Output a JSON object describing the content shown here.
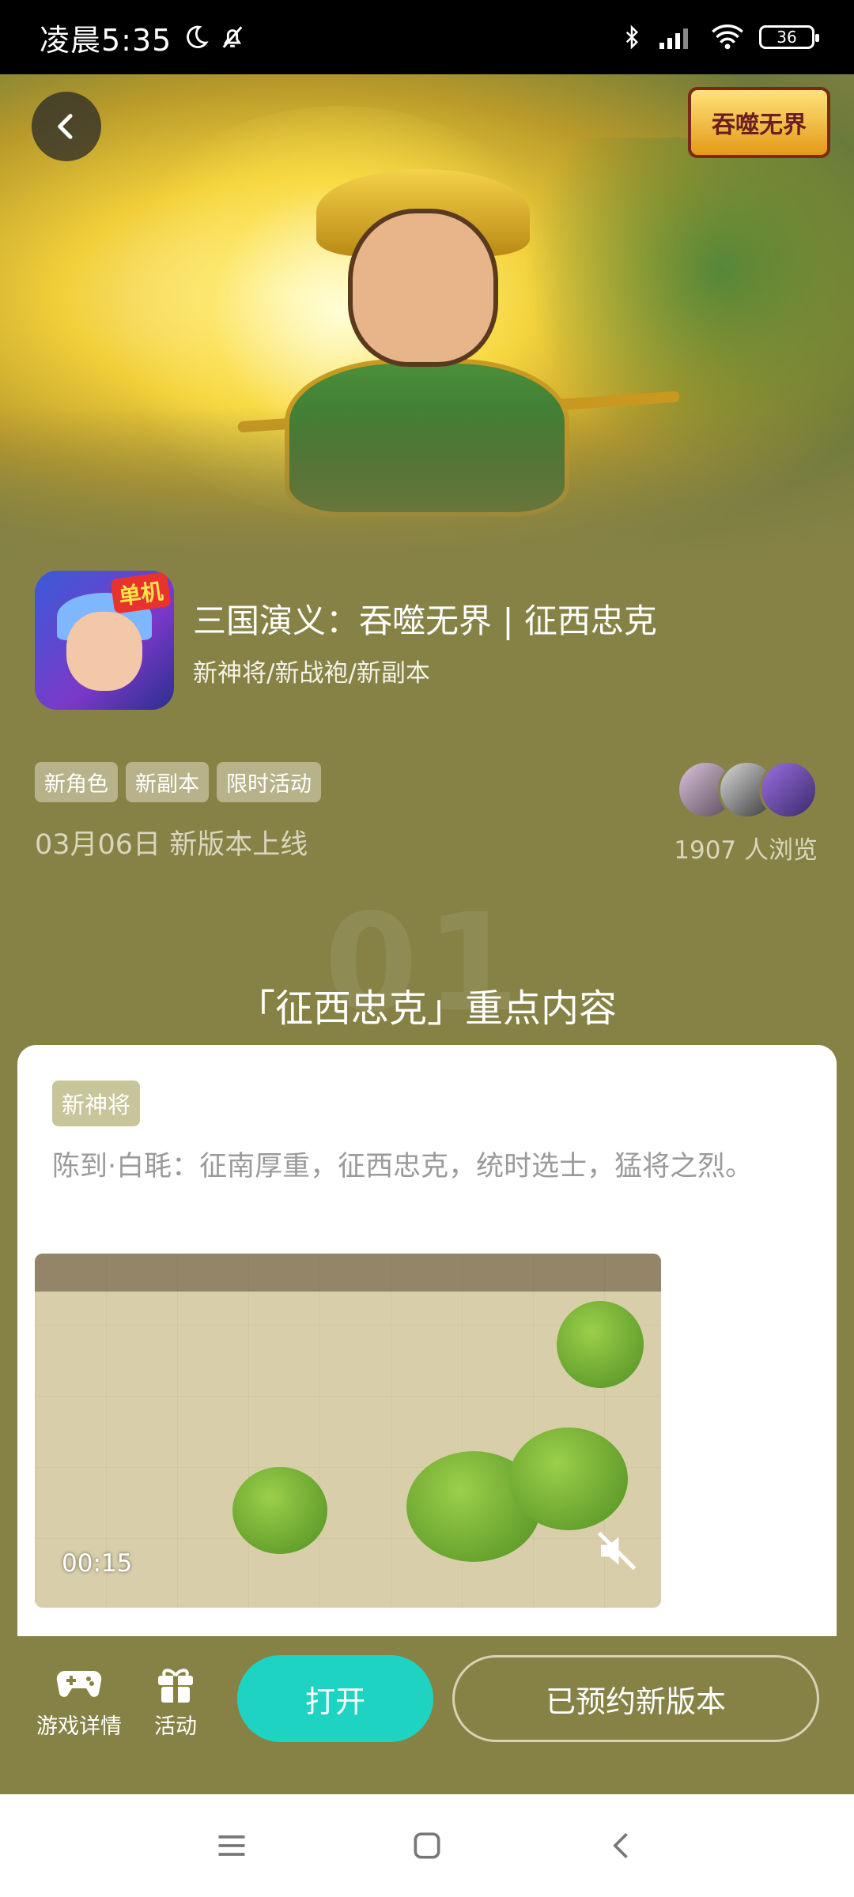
{
  "status_bar": {
    "time": "凌晨5:35",
    "battery": "36",
    "icons": [
      "moon-icon",
      "bell-off-icon",
      "bluetooth-icon",
      "signal-icon",
      "wifi-icon",
      "battery-icon"
    ]
  },
  "hero": {
    "logo_text": "吞噬无界",
    "icons": [
      "back-arrow-icon"
    ]
  },
  "app": {
    "title": "三国演义：吞噬无界 | 征西忠克",
    "subtitle": "新神将/新战袍/新副本",
    "icon_badge": "单机",
    "tags": [
      "新角色",
      "新副本",
      "限时活动"
    ],
    "release": "03月06日 新版本上线",
    "views": "1907 人浏览"
  },
  "section": {
    "number": "01",
    "title": "「征西忠克」重点内容"
  },
  "card": {
    "tag": "新神将",
    "description": "陈到·白毦：征南厚重，征西忠克，统时选士，猛将之烈。",
    "video_time": "00:15"
  },
  "action_bar": {
    "game_details": "游戏详情",
    "activity": "活动",
    "open": "打开",
    "reserved": "已预约新版本"
  },
  "colors": {
    "page_bg": "#868246",
    "accent": "#1fd3c3",
    "tag_bg": "#b7b28a"
  }
}
